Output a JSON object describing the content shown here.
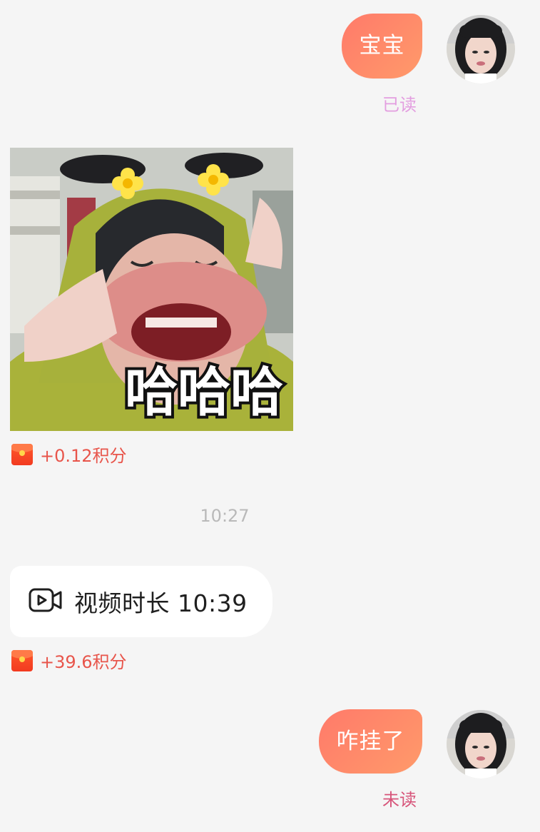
{
  "messages": {
    "m1": {
      "text": "宝宝",
      "status": "已读"
    },
    "m2": {
      "overlay_text": "哈哈哈",
      "reward": "+0.12积分"
    },
    "timestamp": "10:27",
    "m3": {
      "label": "视频时长 10:39",
      "reward": "+39.6积分"
    },
    "m4": {
      "text": "咋挂了",
      "status": "未读"
    }
  },
  "colors": {
    "bubble_out_start": "#ff7a6a",
    "bubble_out_end": "#ff9a6a",
    "read_status": "#e39ee0",
    "unread_status": "#d7557a",
    "reward_text": "#e8554b",
    "timestamp_text": "#b9b9b9"
  },
  "icons": {
    "video": "video-call-icon",
    "reward": "red-packet-icon"
  }
}
